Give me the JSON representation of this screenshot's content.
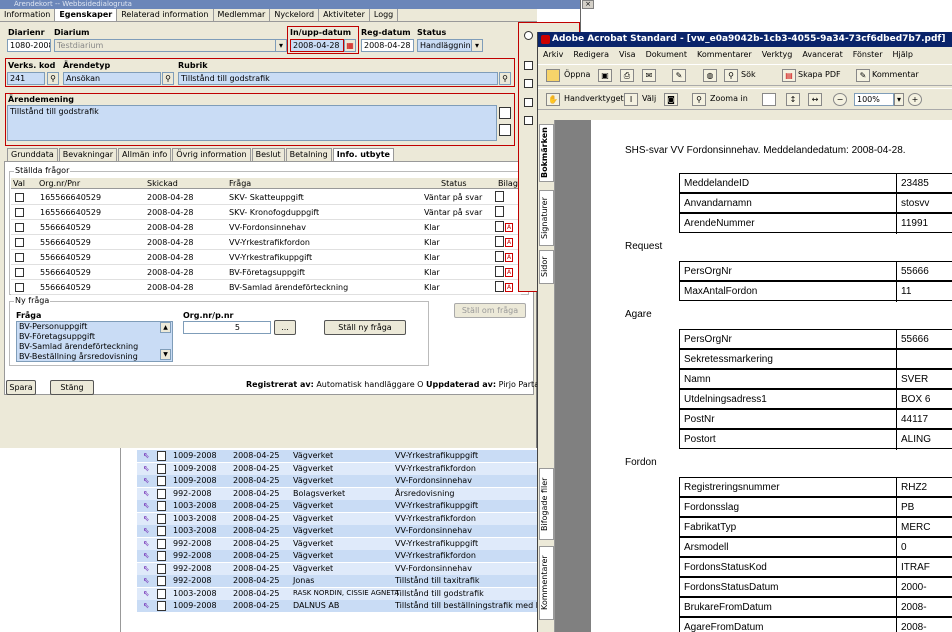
{
  "app": {
    "title": "Ärendekort -- Webbsidedialogruta",
    "tabs": [
      "Information",
      "Egenskaper",
      "Relaterad information",
      "Medlemmar",
      "Nyckelord",
      "Aktiviteter",
      "Logg"
    ],
    "fields": {
      "diarienr_label": "Diarienr",
      "diarienr_value": "1080-2008",
      "diarium_label": "Diarium",
      "diarium_value": "Testdiarium",
      "inupp_label": "In/upp-datum",
      "inupp_value": "2008-04-28",
      "regdatum_label": "Reg-datum",
      "regdatum_value": "2008-04-28",
      "status_label": "Status",
      "status_value": "Handläggning",
      "verkskod_label": "Verks. kod",
      "verkskod_value": "241",
      "arendetyp_label": "Ärendetyp",
      "arendetyp_value": "Ansökan",
      "rubrik_label": "Rubrik",
      "rubrik_value": "Tillstånd till godstrafik",
      "arendemening_label": "Ärendemening",
      "arendemening_value": "Tillstånd till godstrafik"
    },
    "subtabs": [
      "Grunddata",
      "Bevakningar",
      "Allmän info",
      "Övrig information",
      "Beslut",
      "Betalning",
      "Info. utbyte"
    ],
    "stallda_title": "Ställda frågor",
    "columns": [
      "Val",
      "Org.nr/Pnr",
      "Skickad",
      "Fråga",
      "Status",
      "Bilaga"
    ],
    "questions": [
      {
        "org": "165566640529",
        "date": "2008-04-28",
        "q": "SKV- Skatteuppgift",
        "status": "Väntar på svar",
        "pdf": false
      },
      {
        "org": "165566640529",
        "date": "2008-04-28",
        "q": "SKV- Kronofogduppgift",
        "status": "Väntar på svar",
        "pdf": false
      },
      {
        "org": "5566640529",
        "date": "2008-04-28",
        "q": "VV-Fordonsinnehav",
        "status": "Klar",
        "pdf": true
      },
      {
        "org": "5566640529",
        "date": "2008-04-28",
        "q": "VV-Yrkestrafikfordon",
        "status": "Klar",
        "pdf": true
      },
      {
        "org": "5566640529",
        "date": "2008-04-28",
        "q": "VV-Yrkestrafikuppgift",
        "status": "Klar",
        "pdf": true
      },
      {
        "org": "5566640529",
        "date": "2008-04-28",
        "q": "BV-Företagsuppgift",
        "status": "Klar",
        "pdf": true
      },
      {
        "org": "5566640529",
        "date": "2008-04-28",
        "q": "BV-Samlad ärendeförteckning",
        "status": "Klar",
        "pdf": true
      }
    ],
    "stall_om_label": "Ställ om fråga",
    "ny_fraga_title": "Ny fråga",
    "fraga_label": "Fråga",
    "orgnr_label": "Org.nr/p.nr",
    "orgnr_value": "5",
    "ellipsis_label": "...",
    "stall_ny_label": "Ställ ny fråga",
    "fraga_options": [
      "BV-Personuppgift",
      "BV-Företagsuppgift",
      "BV-Samlad ärendeförteckning",
      "BV-Beställning årsredovisning"
    ],
    "spara_label": "Spara",
    "stang_label": "Stäng",
    "registrerat_label": "Registrerat av:",
    "registrerat_value": "Automatisk handläggare O",
    "uppdaterat_label": "Uppdaterad av:",
    "uppdaterat_value": "Pirjo Partane"
  },
  "bottom_list": [
    {
      "nr": "1009-2008",
      "date": "2008-04-25",
      "org": "Vägverket",
      "q": "VV-Yrkestrafikuppgift"
    },
    {
      "nr": "1009-2008",
      "date": "2008-04-25",
      "org": "Vägverket",
      "q": "VV-Yrkestrafikfordon"
    },
    {
      "nr": "1009-2008",
      "date": "2008-04-25",
      "org": "Vägverket",
      "q": "VV-Fordonsinnehav"
    },
    {
      "nr": "992-2008",
      "date": "2008-04-25",
      "org": "Bolagsverket",
      "q": "Årsredovisning"
    },
    {
      "nr": "1003-2008",
      "date": "2008-04-25",
      "org": "Vägverket",
      "q": "VV-Yrkestrafikuppgift"
    },
    {
      "nr": "1003-2008",
      "date": "2008-04-25",
      "org": "Vägverket",
      "q": "VV-Yrkestrafikfordon"
    },
    {
      "nr": "1003-2008",
      "date": "2008-04-25",
      "org": "Vägverket",
      "q": "VV-Fordonsinnehav"
    },
    {
      "nr": "992-2008",
      "date": "2008-04-25",
      "org": "Vägverket",
      "q": "VV-Yrkestrafikuppgift"
    },
    {
      "nr": "992-2008",
      "date": "2008-04-25",
      "org": "Vägverket",
      "q": "VV-Yrkestrafikfordon"
    },
    {
      "nr": "992-2008",
      "date": "2008-04-25",
      "org": "Vägverket",
      "q": "VV-Fordonsinnehav"
    },
    {
      "nr": "992-2008",
      "date": "2008-04-25",
      "org": "Jonas",
      "q": "Tillstånd till taxitrafik"
    },
    {
      "nr": "1003-2008",
      "date": "2008-04-25",
      "org": "RASK NORDIN, CISSIE AGNETA",
      "q": "Tillstånd till godstrafik"
    },
    {
      "nr": "1009-2008",
      "date": "2008-04-25",
      "org": "DALNUS AB",
      "q": "Tillstånd till beställningstrafik med buss"
    }
  ],
  "acrobat": {
    "title": "Adobe Acrobat Standard - [vw_e0a9042b-1cb3-4055-9a34-73cf6dbed7b7.pdf]",
    "menu": [
      "Arkiv",
      "Redigera",
      "Visa",
      "Dokument",
      "Kommentarer",
      "Verktyg",
      "Avancerat",
      "Fönster",
      "Hjälp"
    ],
    "toolbar1": {
      "open": "Öppna",
      "search": "Sök",
      "create_pdf": "Skapa PDF",
      "comment": "Kommentar"
    },
    "toolbar2": {
      "hand": "Handverktyget",
      "select": "Välj",
      "zoom": "Zooma in",
      "zoom_value": "100%"
    },
    "side_tabs": [
      "Bokmärken",
      "Signaturer",
      "Sidor",
      "Bifogade filer",
      "Kommentarer"
    ],
    "doc": {
      "heading": "SHS-svar VV Fordonsinnehav. Meddelandedatum: 2008-04-28.",
      "sections": [
        {
          "title": "",
          "rows": [
            [
              "MeddelandeID",
              "23485"
            ],
            [
              "Anvandarnamn",
              "stosvv"
            ],
            [
              "ArendeNummer",
              "11991"
            ]
          ]
        },
        {
          "title": "Request",
          "rows": [
            [
              "PersOrgNr",
              "55666"
            ],
            [
              "MaxAntalFordon",
              "11"
            ]
          ]
        },
        {
          "title": "Agare",
          "rows": [
            [
              "PersOrgNr",
              "55666"
            ],
            [
              "Sekretessmarkering",
              ""
            ],
            [
              "Namn",
              "SVER"
            ],
            [
              "Utdelningsadress1",
              "BOX 6"
            ],
            [
              "PostNr",
              "44117"
            ],
            [
              "Postort",
              "ALING"
            ]
          ]
        },
        {
          "title": "Fordon",
          "rows": [
            [
              "Registreringsnummer",
              "RHZ2"
            ],
            [
              "Fordonsslag",
              "PB"
            ],
            [
              "FabrikatTyp",
              "MERC"
            ],
            [
              "Arsmodell",
              "0"
            ],
            [
              "FordonsStatusKod",
              "ITRAF"
            ],
            [
              "FordonsStatusDatum",
              "2000-"
            ],
            [
              "BrukareFromDatum",
              "2008-"
            ],
            [
              "AgareFromDatum",
              "2008-"
            ]
          ]
        }
      ]
    }
  }
}
